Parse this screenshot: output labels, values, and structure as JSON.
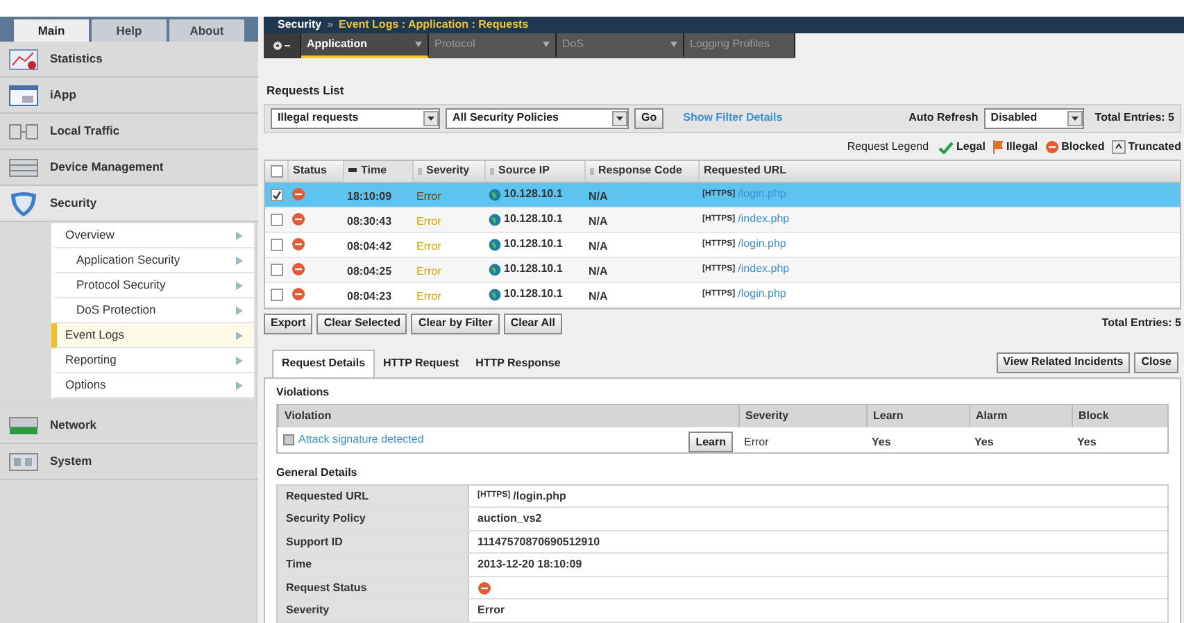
{
  "sidebar": {
    "tabs": [
      {
        "label": "Main",
        "selected": true
      },
      {
        "label": "Help",
        "selected": false
      },
      {
        "label": "About",
        "selected": false
      }
    ],
    "items": [
      {
        "label": "Statistics",
        "kind": "chart",
        "expanded": false
      },
      {
        "label": "iApp",
        "kind": "window",
        "expanded": false
      },
      {
        "label": "Local Traffic",
        "kind": "traffic",
        "expanded": false
      },
      {
        "label": "Device Management",
        "kind": "device",
        "expanded": false
      },
      {
        "label": "Security",
        "kind": "shield",
        "expanded": true,
        "children": [
          {
            "label": "Overview",
            "selected": false,
            "children": [
              {
                "label": "Application Security",
                "selected": false
              },
              {
                "label": "Protocol Security",
                "selected": false
              },
              {
                "label": "DoS Protection",
                "selected": false
              }
            ]
          },
          {
            "label": "Event Logs",
            "selected": true
          },
          {
            "label": "Reporting",
            "selected": false
          },
          {
            "label": "Options",
            "selected": false
          }
        ]
      },
      {
        "label": "Network",
        "kind": "network",
        "expanded": false
      },
      {
        "label": "System",
        "kind": "system",
        "expanded": false
      }
    ]
  },
  "breadcrumb": {
    "root": "Security",
    "separator": "»",
    "path": "Event Logs : Application : Requests"
  },
  "subnav": [
    {
      "label": "Application",
      "selected": true,
      "dropdown": true
    },
    {
      "label": "Protocol",
      "selected": false,
      "dropdown": true
    },
    {
      "label": "DoS",
      "selected": false,
      "dropdown": true
    },
    {
      "label": "Logging Profiles",
      "selected": false,
      "dropdown": false
    }
  ],
  "requests_list": {
    "title": "Requests List",
    "filters": [
      {
        "value": "Illegal requests"
      },
      {
        "value": "All Security Policies"
      }
    ],
    "go_button": "Go",
    "filter_link": "Show Filter Details",
    "auto_refresh_label": "Auto Refresh",
    "auto_refresh_value": "Disabled",
    "total_entries": "Total Entries: 5"
  },
  "legend": {
    "label": "Request Legend",
    "items": [
      {
        "label": "Legal",
        "kind": "legal"
      },
      {
        "label": "Illegal",
        "kind": "illegal"
      },
      {
        "label": "Blocked",
        "kind": "blocked"
      },
      {
        "label": "Truncated",
        "kind": "truncated"
      }
    ]
  },
  "table": {
    "select_all_checked": false,
    "columns": [
      {
        "label": "Status",
        "sorted": false
      },
      {
        "label": "Time",
        "sorted": true
      },
      {
        "label": "Severity",
        "sorted": false
      },
      {
        "label": "Source IP",
        "sorted": false
      },
      {
        "label": "Response Code",
        "sorted": false
      },
      {
        "label": "Requested URL",
        "sorted": false
      }
    ],
    "rows": [
      {
        "selected": true,
        "checked": true,
        "time": "18:10:09",
        "severity": "Error",
        "source_ip": "10.128.10.1",
        "response_code": "N/A",
        "protocol": "[HTTPS]",
        "url": "/login.php"
      },
      {
        "selected": false,
        "checked": false,
        "time": "08:30:43",
        "severity": "Error",
        "source_ip": "10.128.10.1",
        "response_code": "N/A",
        "protocol": "[HTTPS]",
        "url": "/index.php"
      },
      {
        "selected": false,
        "checked": false,
        "time": "08:04:42",
        "severity": "Error",
        "source_ip": "10.128.10.1",
        "response_code": "N/A",
        "protocol": "[HTTPS]",
        "url": "/login.php"
      },
      {
        "selected": false,
        "checked": false,
        "time": "08:04:25",
        "severity": "Error",
        "source_ip": "10.128.10.1",
        "response_code": "N/A",
        "protocol": "[HTTPS]",
        "url": "/index.php"
      },
      {
        "selected": false,
        "checked": false,
        "time": "08:04:23",
        "severity": "Error",
        "source_ip": "10.128.10.1",
        "response_code": "N/A",
        "protocol": "[HTTPS]",
        "url": "/login.php"
      }
    ]
  },
  "table_actions": {
    "buttons": [
      "Export",
      "Clear Selected",
      "Clear by Filter",
      "Clear All"
    ],
    "total_entries": "Total Entries: 5"
  },
  "details": {
    "tabs": [
      {
        "label": "Request Details",
        "selected": true
      },
      {
        "label": "HTTP Request",
        "selected": false
      },
      {
        "label": "HTTP Response",
        "selected": false
      }
    ],
    "buttons": [
      "View Related Incidents",
      "Close"
    ],
    "violations": {
      "title": "Violations",
      "columns": [
        "Violation",
        "Severity",
        "Learn",
        "Alarm",
        "Block"
      ],
      "rows": [
        {
          "violation": "Attack signature detected",
          "learn_button": "Learn",
          "severity": "Error",
          "learn": "Yes",
          "alarm": "Yes",
          "block": "Yes"
        }
      ]
    },
    "general": {
      "title": "General Details",
      "rows": [
        {
          "label": "Requested URL",
          "kind": "url",
          "protocol": "[HTTPS]",
          "value": "/login.php"
        },
        {
          "label": "Security Policy",
          "kind": "text",
          "value": "auction_vs2"
        },
        {
          "label": "Support ID",
          "kind": "text",
          "value": "11147570870690512910"
        },
        {
          "label": "Time",
          "kind": "text",
          "value": "2013-12-20 18:10:09"
        },
        {
          "label": "Request Status",
          "kind": "status"
        },
        {
          "label": "Severity",
          "kind": "text",
          "value": "Error"
        }
      ]
    }
  }
}
